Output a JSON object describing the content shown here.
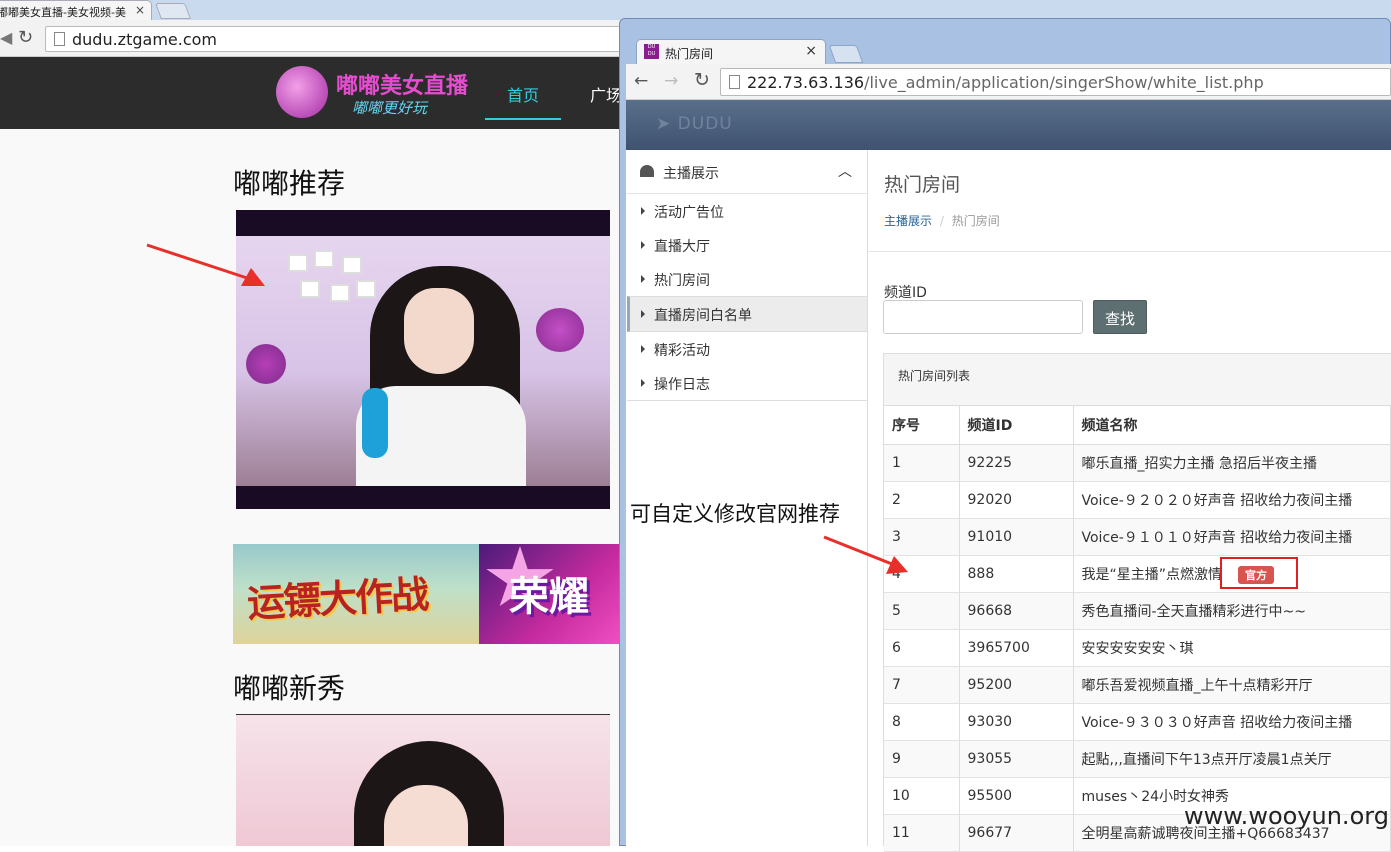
{
  "back_browser": {
    "tab_title": "嘟嘟美女直播-美女视频-美",
    "tab_close": "×",
    "url": "dudu.ztgame.com"
  },
  "site": {
    "logo_title": "嘟嘟美女直播",
    "logo_slogan": "嘟嘟更好玩",
    "nav_items": [
      "首页",
      "广场"
    ],
    "section_recommend": "嘟嘟推荐",
    "section_new": "嘟嘟新秀",
    "banner1_text": "运镖大作战",
    "banner2_text": "荣耀"
  },
  "front_browser": {
    "tab_title": "热门房间",
    "tab_icon_text": "DU DU",
    "tab_close": "×",
    "url_host": "222.73.63.136",
    "url_path": "/live_admin/application/singerShow/white_list.php"
  },
  "admin": {
    "brand": "DUDU",
    "sidebar": {
      "header": "主播展示",
      "items": [
        "活动广告位",
        "直播大厅",
        "热门房间",
        "直播房间白名单",
        "精彩活动",
        "操作日志"
      ],
      "active_index": 3
    },
    "page_title": "热门房间",
    "breadcrumb": {
      "parent": "主播展示",
      "separator": "/",
      "current": "热门房间"
    },
    "filter": {
      "label": "频道ID",
      "value": "",
      "button": "查找"
    },
    "panel_title": "热门房间列表",
    "table": {
      "columns": [
        "序号",
        "频道ID",
        "频道名称"
      ],
      "rows": [
        {
          "no": "1",
          "id": "92225",
          "name": "嘟乐直播_招实力主播 急招后半夜主播"
        },
        {
          "no": "2",
          "id": "92020",
          "name": "Voice-９２０２０好声音 招收给力夜间主播"
        },
        {
          "no": "3",
          "id": "91010",
          "name": "Voice-９１０１０好声音 招收给力夜间主播"
        },
        {
          "no": "4",
          "id": "888",
          "name": "我是“星主播”点燃激情",
          "badge": "官方"
        },
        {
          "no": "5",
          "id": "96668",
          "name": "秀色直播间-全天直播精彩进行中~~"
        },
        {
          "no": "6",
          "id": "3965700",
          "name": "安安安安安安丶琪"
        },
        {
          "no": "7",
          "id": "95200",
          "name": "嘟乐吾爱视频直播_上午十点精彩开厅"
        },
        {
          "no": "8",
          "id": "93030",
          "name": "Voice-９３０３０好声音 招收给力夜间主播"
        },
        {
          "no": "9",
          "id": "93055",
          "name": "起點,,,直播间下午13点开厅凌晨1点关厅"
        },
        {
          "no": "10",
          "id": "95500",
          "name": "muses丶24小时女神秀"
        },
        {
          "no": "11",
          "id": "96677",
          "name": "全明星高薪诚聘夜间主播+Q66683437"
        }
      ]
    }
  },
  "annotation": "可自定义修改官网推荐",
  "watermark": "www.wooyun.org",
  "colors": {
    "site_accent": "#33cce0",
    "brand_pink": "#e64ccf",
    "badge_red": "#d9534f",
    "highlight": "#e02020",
    "navbar": "#4a5e7b"
  }
}
